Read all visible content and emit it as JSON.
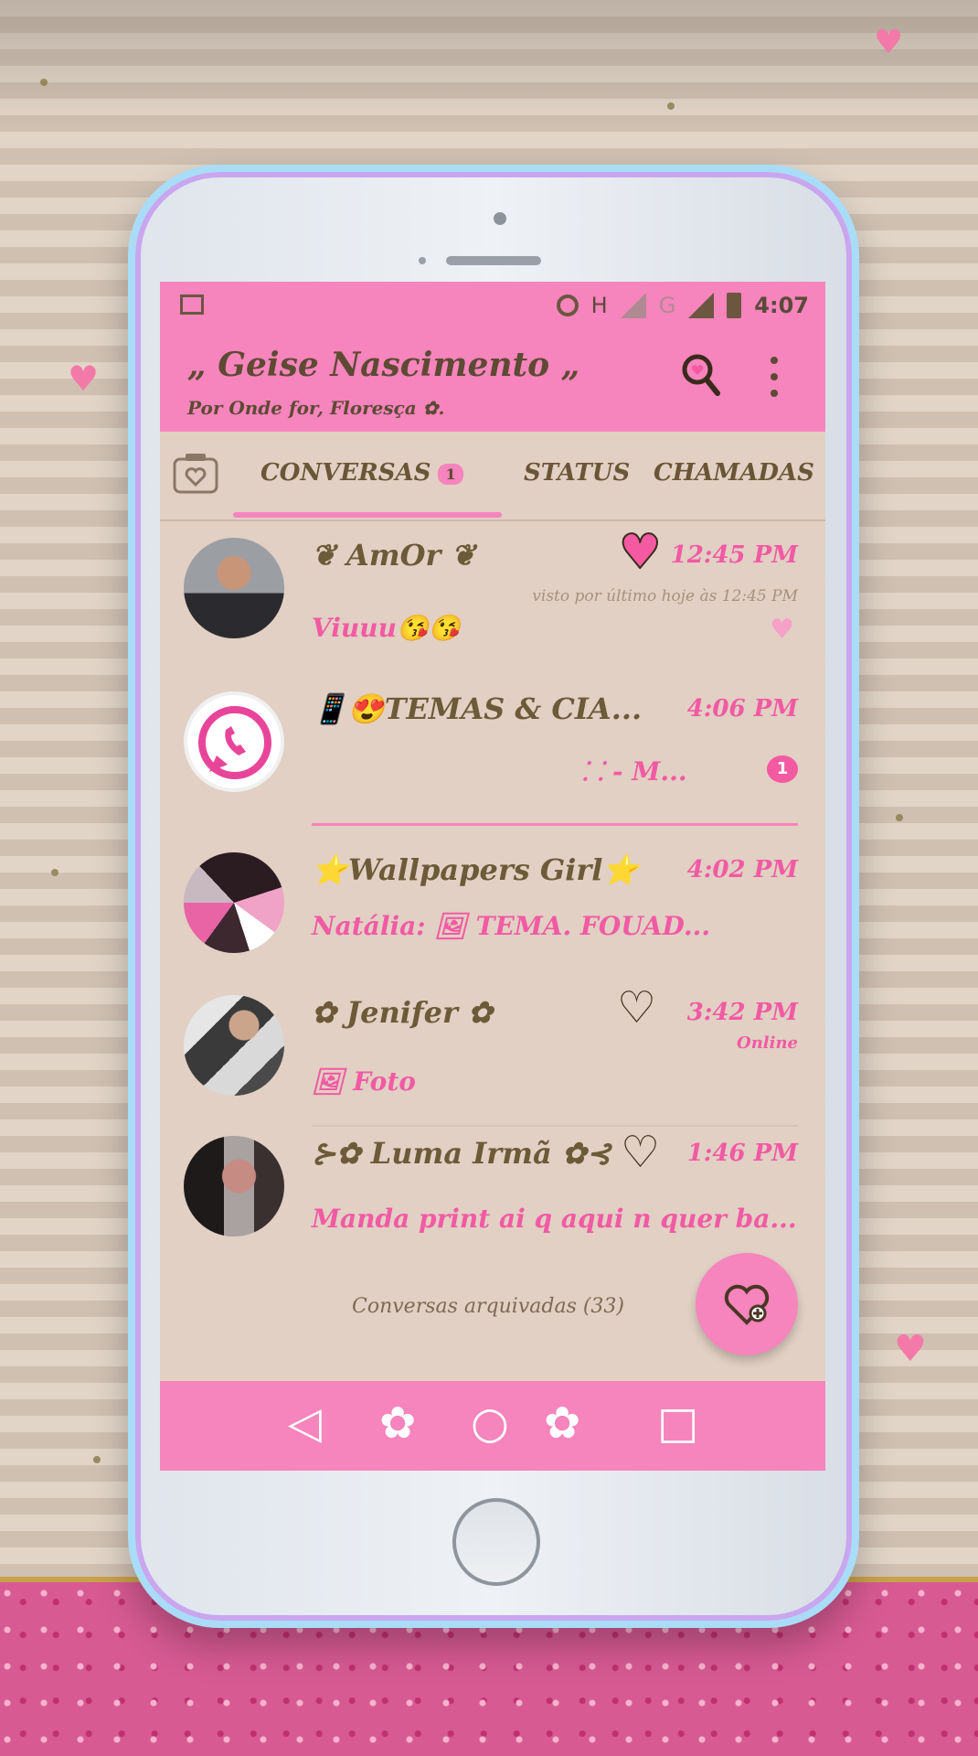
{
  "status_bar": {
    "network_h": "H",
    "network_g": "G",
    "time": "4:07",
    "icons": [
      "image-icon",
      "recording-icon",
      "signal-icon",
      "signal-icon",
      "battery-icon"
    ]
  },
  "app_bar": {
    "title": "„ Geise Nascimento „",
    "subtitle": "Por Onde for, Floresça ✿.",
    "actions": [
      "search-heart-icon",
      "more-vert-icon"
    ]
  },
  "tabs": {
    "conversas": "CONVERSAS",
    "conversas_badge": "1",
    "status": "STATUS",
    "chamadas": "CHAMADAS"
  },
  "chats": [
    {
      "name": "❦ AmOr ❦",
      "time": "12:45 PM",
      "subtext": "visto por último hoje às 12:45 PM",
      "message": "Viuuu😘😘",
      "marker": "heart"
    },
    {
      "name": "📱😍TEMAS & CIA...",
      "time": "4:06 PM",
      "message": "⸬ - M...",
      "unread": "1"
    },
    {
      "name": "⭐Wallpapers Girl⭐",
      "time": "4:02 PM",
      "message": "Natália: 🖼 TEMA. FOUAD..."
    },
    {
      "name": "✿ Jenifer ✿",
      "time": "3:42 PM",
      "subtext": "Online",
      "message": "🖼 Foto"
    },
    {
      "name": "⊱✿ Luma Irmã ✿⊰",
      "time": "1:46 PM",
      "message": "Manda print ai q aqui n quer ba..."
    }
  ],
  "archived": "Conversas arquivadas (33)",
  "colors": {
    "accent_pink": "#f684bd",
    "screen_bg": "#e1d0c3",
    "text_brown": "#6c5a38",
    "time_pink": "#f25aa4"
  }
}
